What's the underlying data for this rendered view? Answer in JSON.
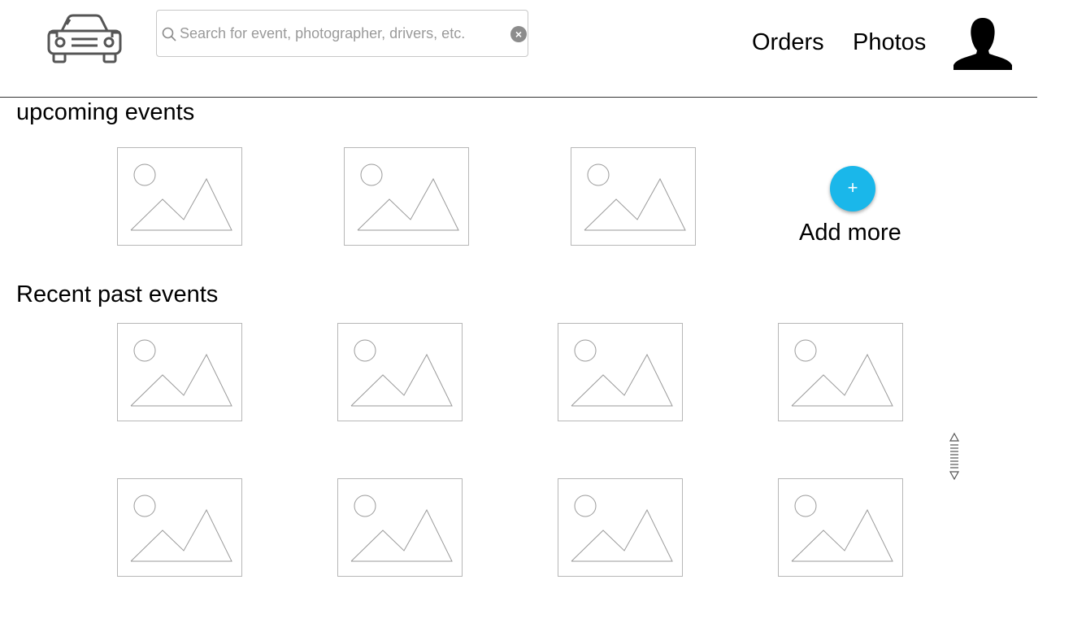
{
  "header": {
    "logo_icon": "car-icon",
    "search": {
      "placeholder": "Search for event, photographer, drivers, etc.",
      "value": "",
      "clear_symbol": "×"
    },
    "nav": {
      "orders_label": "Orders",
      "photos_label": "Photos"
    },
    "avatar_icon": "user-silhouette-icon"
  },
  "upcoming": {
    "title": "upcoming events",
    "items": [
      {
        "icon": "image-placeholder-icon"
      },
      {
        "icon": "image-placeholder-icon"
      },
      {
        "icon": "image-placeholder-icon"
      }
    ],
    "add_more": {
      "symbol": "+",
      "label": "Add more",
      "color": "#1ab7ea"
    }
  },
  "recent": {
    "title": "Recent past events",
    "rows": [
      [
        {
          "icon": "image-placeholder-icon"
        },
        {
          "icon": "image-placeholder-icon"
        },
        {
          "icon": "image-placeholder-icon"
        },
        {
          "icon": "image-placeholder-icon"
        }
      ],
      [
        {
          "icon": "image-placeholder-icon"
        },
        {
          "icon": "image-placeholder-icon"
        },
        {
          "icon": "image-placeholder-icon"
        },
        {
          "icon": "image-placeholder-icon"
        }
      ]
    ]
  },
  "scroll_handle_icon": "vertical-resize-handle-icon"
}
